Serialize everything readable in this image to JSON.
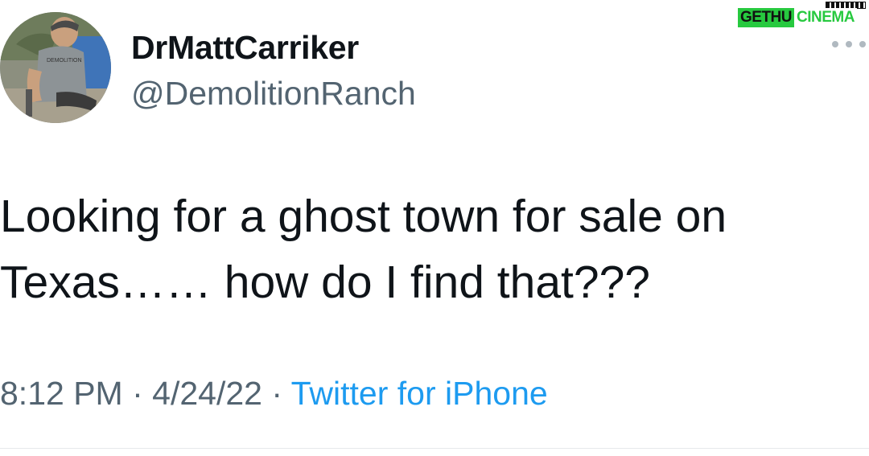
{
  "user": {
    "display_name": "DrMattCarriker",
    "handle": "@DemolitionRanch",
    "shirt_text": "DEMOLITION"
  },
  "tweet": {
    "text_line1": "Looking for a ghost town for sale on",
    "text_line2": "Texas…… how do I find that???"
  },
  "meta": {
    "time": "8:12 PM",
    "separator": " · ",
    "date": "4/24/22",
    "source": "Twitter for iPhone"
  },
  "watermark": {
    "part1": "GETHU",
    "part2": "CINEMA"
  },
  "colors": {
    "text": "#0f1419",
    "secondary": "#536471",
    "link": "#1d9bf0",
    "watermark": "#27c93f"
  },
  "icons": {
    "more": "more-horizontal-icon"
  }
}
